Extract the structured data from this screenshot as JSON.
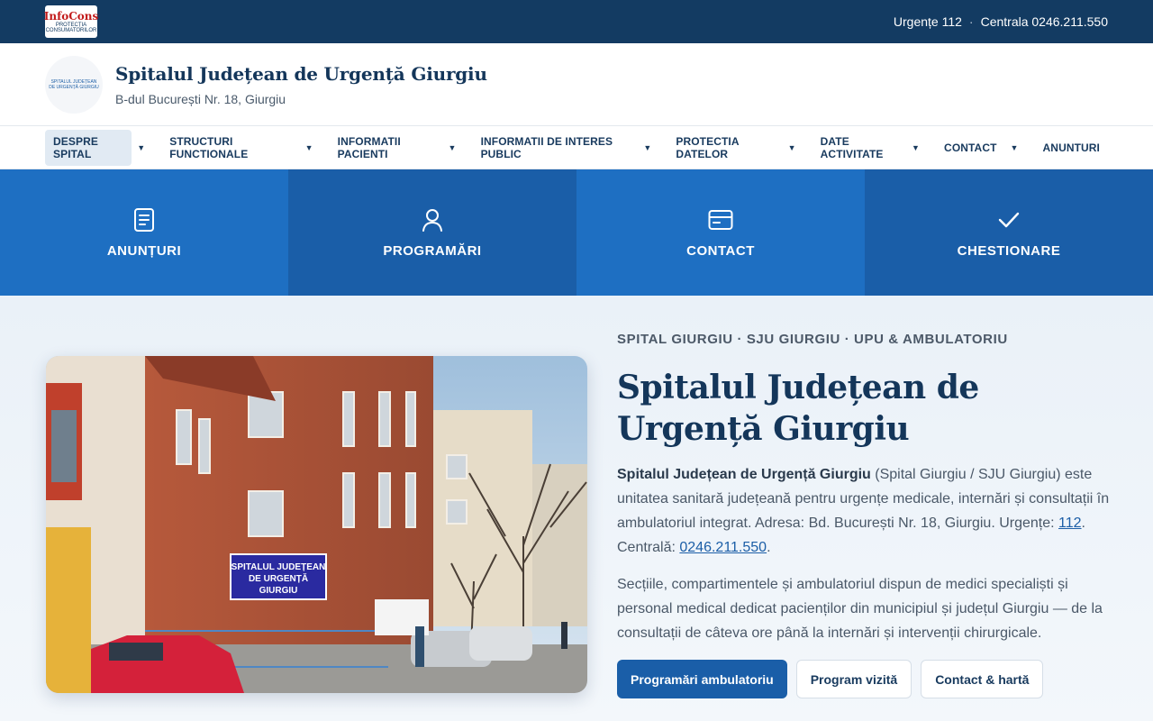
{
  "topbar": {
    "logo_title": "InfoCons",
    "logo_subtitle": "PROTECȚIA CONSUMATORILOR",
    "urgente": "Urgențe 112",
    "separator": "·",
    "centrala": "Centrala 0246.211.550"
  },
  "header": {
    "logo_text": "SPITALUL JUDEȚEAN DE URGENȚĂ GIURGIU",
    "title": "Spitalul Județean de Urgență Giurgiu",
    "address": "B-dul București Nr. 18, Giurgiu"
  },
  "nav": {
    "items": [
      {
        "label": "DESPRE SPITAL"
      },
      {
        "label": "STRUCTURI FUNCTIONALE"
      },
      {
        "label": "INFORMATII PACIENTI"
      },
      {
        "label": "INFORMATII DE INTERES PUBLIC"
      },
      {
        "label": "PROTECTIA DATELOR"
      },
      {
        "label": "DATE ACTIVITATE"
      },
      {
        "label": "CONTACT"
      },
      {
        "label": "ANUNTURI"
      }
    ],
    "caret": "▼"
  },
  "tiles": [
    {
      "label": "ANUNȚURI",
      "icon": "document-icon"
    },
    {
      "label": "PROGRAMĂRI",
      "icon": "user-icon"
    },
    {
      "label": "CONTACT",
      "icon": "card-icon"
    },
    {
      "label": "CHESTIONARE",
      "icon": "check-icon"
    }
  ],
  "photo": {
    "sign_line1": "SPITALUL JUDEȚEAN",
    "sign_line2": "DE URGENȚĂ",
    "sign_line3": "GIURGIU"
  },
  "hero": {
    "eyebrow": "SPITAL GIURGIU · SJU GIURGIU · UPU & AMBULATORIU",
    "title": "Spitalul Județean de Urgență Giurgiu",
    "p1_bold": "Spitalul Județean de Urgență Giurgiu",
    "p1_text": " (Spital Giurgiu / SJU Giurgiu) este unitatea sanitară județeană pentru urgențe medicale, internări și consultații în ambulatoriul integrat. Adresa: Bd. București Nr. 18, Giurgiu. Urgențe: ",
    "p1_link1": "112",
    "p1_mid": ". Centrală: ",
    "p1_link2": "0246.211.550",
    "p1_end": ".",
    "p2": "Secțiile, compartimentele și ambulatoriul dispun de medici specialiști și personal medical dedicat pacienților din municipiul și județul Giurgiu — de la consultații de câteva ore până la internări și intervenții chirurgicale.",
    "buttons": [
      "Programări ambulatoriu",
      "Program vizită",
      "Contact & hartă"
    ]
  },
  "colors": {
    "topbar": "#133b62",
    "accent": "#1a5ea8",
    "tile_light": "#1e6fc2",
    "tile_dark": "#1a5ea8"
  }
}
